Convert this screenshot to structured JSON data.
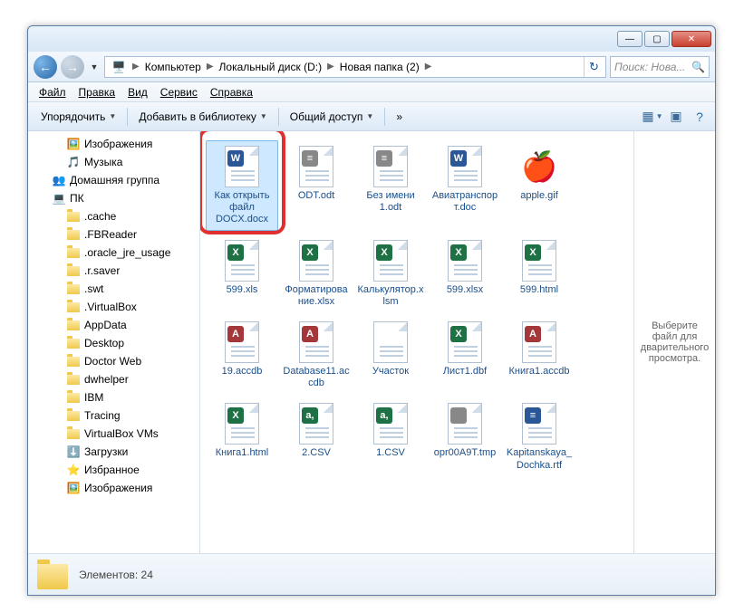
{
  "titlebar": {
    "min": "—",
    "max": "▢",
    "close": "✕"
  },
  "nav_back": "←",
  "nav_fwd": "→",
  "breadcrumbs": [
    "Компьютер",
    "Локальный диск (D:)",
    "Новая папка (2)"
  ],
  "refresh": "↻",
  "search": {
    "placeholder": "Поиск: Нова..."
  },
  "menu": [
    "Файл",
    "Правка",
    "Вид",
    "Сервис",
    "Справка"
  ],
  "toolbar": {
    "organize": "Упорядочить",
    "library": "Добавить в библиотеку",
    "share": "Общий доступ",
    "more": "»"
  },
  "tree": [
    {
      "label": "Изображения",
      "level": 1,
      "icon": "pics"
    },
    {
      "label": "Музыка",
      "level": 1,
      "icon": "music"
    },
    {
      "label": "Домашняя группа",
      "level": 0,
      "icon": "home"
    },
    {
      "label": "ПК",
      "level": 0,
      "icon": "pc"
    },
    {
      "label": ".cache",
      "level": 1,
      "icon": "folder"
    },
    {
      "label": ".FBReader",
      "level": 1,
      "icon": "folder"
    },
    {
      "label": ".oracle_jre_usage",
      "level": 1,
      "icon": "folder"
    },
    {
      "label": ".r.saver",
      "level": 1,
      "icon": "folder"
    },
    {
      "label": ".swt",
      "level": 1,
      "icon": "folder"
    },
    {
      "label": ".VirtualBox",
      "level": 1,
      "icon": "folder"
    },
    {
      "label": "AppData",
      "level": 1,
      "icon": "folder"
    },
    {
      "label": "Desktop",
      "level": 1,
      "icon": "folder"
    },
    {
      "label": "Doctor Web",
      "level": 1,
      "icon": "folder"
    },
    {
      "label": "dwhelper",
      "level": 1,
      "icon": "folder"
    },
    {
      "label": "IBM",
      "level": 1,
      "icon": "folder"
    },
    {
      "label": "Tracing",
      "level": 1,
      "icon": "folder"
    },
    {
      "label": "VirtualBox VMs",
      "level": 1,
      "icon": "folder"
    },
    {
      "label": "Загрузки",
      "level": 1,
      "icon": "dl"
    },
    {
      "label": "Избранное",
      "level": 1,
      "icon": "fav"
    },
    {
      "label": "Изображения",
      "level": 1,
      "icon": "pics"
    }
  ],
  "files": [
    {
      "name": "Как открыть файл DOCX.docx",
      "type": "docx",
      "selected": true
    },
    {
      "name": "ODT.odt",
      "type": "odt"
    },
    {
      "name": "Без имени 1.odt",
      "type": "odt"
    },
    {
      "name": "Авиатранспорт.doc",
      "type": "doc"
    },
    {
      "name": "apple.gif",
      "type": "gif"
    },
    {
      "name": "599.xls",
      "type": "xls"
    },
    {
      "name": "Форматирование.xlsx",
      "type": "xlsx"
    },
    {
      "name": "Калькулятор.xlsm",
      "type": "xlsm"
    },
    {
      "name": "599.xlsx",
      "type": "xlsx"
    },
    {
      "name": "599.html",
      "type": "html"
    },
    {
      "name": "19.accdb",
      "type": "accdb"
    },
    {
      "name": "Database11.accdb",
      "type": "accdb"
    },
    {
      "name": "Участок",
      "type": "blank"
    },
    {
      "name": "Лист1.dbf",
      "type": "xls"
    },
    {
      "name": "Книга1.accdb",
      "type": "accdb"
    },
    {
      "name": "Книга1.html",
      "type": "html"
    },
    {
      "name": "2.CSV",
      "type": "csv"
    },
    {
      "name": "1.CSV",
      "type": "csv"
    },
    {
      "name": "opr00A9T.tmp",
      "type": "tmp"
    },
    {
      "name": "Kapitanskaya_Dochka.rtf",
      "type": "rtf"
    }
  ],
  "preview_text": "Выберите файл для дварительного просмотра.",
  "status": {
    "count_label": "Элементов:",
    "count": "24"
  }
}
